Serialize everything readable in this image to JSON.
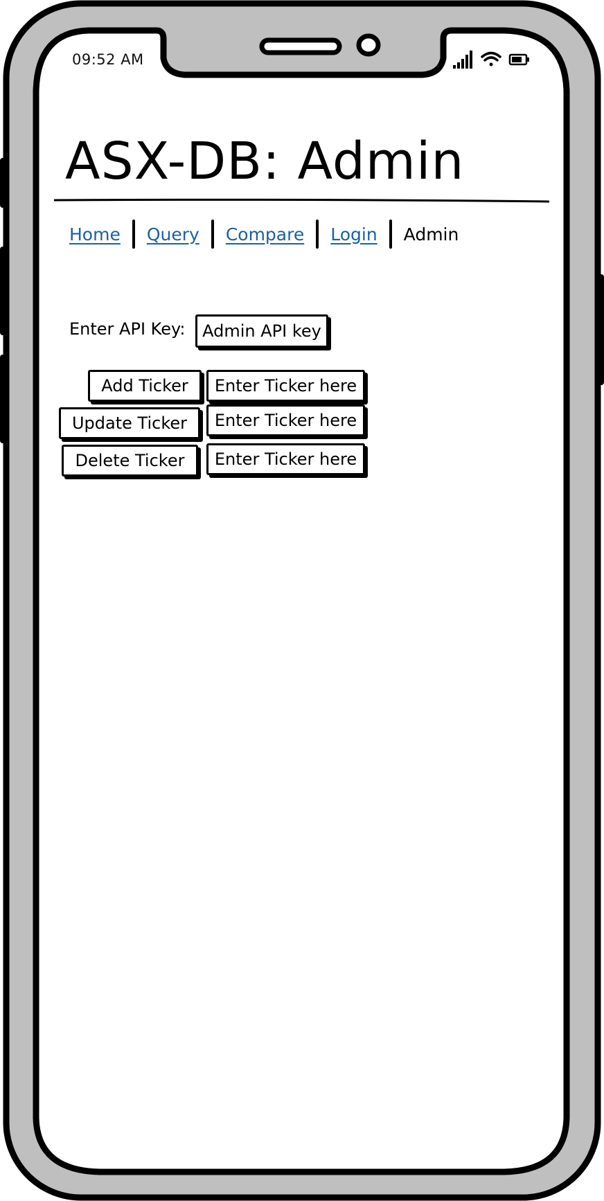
{
  "status_bar": {
    "time": "09:52 AM",
    "icons": [
      "signal-icon",
      "wifi-icon",
      "battery-icon"
    ]
  },
  "page": {
    "title": "ASX-DB: Admin"
  },
  "nav": {
    "items": [
      {
        "label": "Home",
        "link": true
      },
      {
        "label": "Query",
        "link": true
      },
      {
        "label": "Compare",
        "link": true
      },
      {
        "label": "Login",
        "link": true
      },
      {
        "label": "Admin",
        "link": false
      }
    ]
  },
  "admin_form": {
    "api_key_label": "Enter API Key:",
    "api_key_placeholder": "Admin API key",
    "actions": [
      {
        "button_label": "Add Ticker",
        "input_placeholder": "Enter Ticker here"
      },
      {
        "button_label": "Update Ticker",
        "input_placeholder": "Enter Ticker here"
      },
      {
        "button_label": "Delete Ticker",
        "input_placeholder": "Enter Ticker here"
      }
    ]
  },
  "colors": {
    "frame": "#bfbfbf",
    "outline": "#000000",
    "link": "#1f5fa0"
  }
}
